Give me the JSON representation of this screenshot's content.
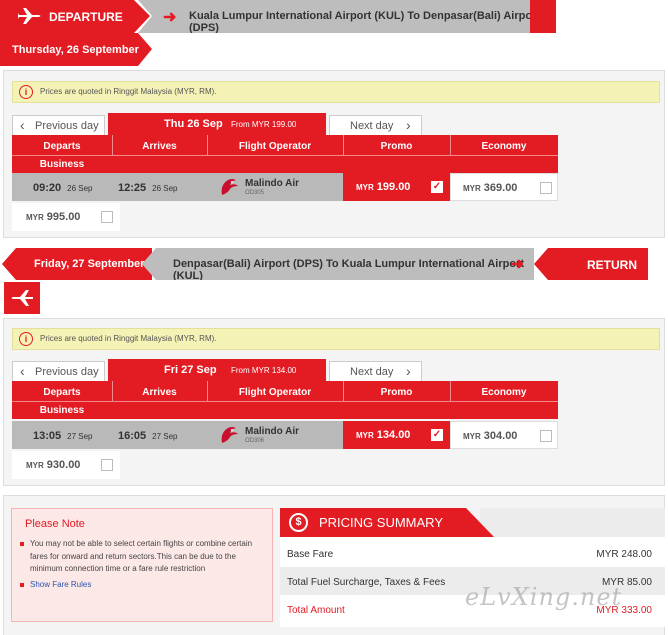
{
  "departure": {
    "label": "DEPARTURE",
    "route": "Kuala Lumpur International Airport (KUL) To Denpasar(Bali) Airport (DPS)",
    "date": "Thursday, 26 September",
    "notice": "Prices are quoted in Ringgit Malaysia (MYR, RM).",
    "prev_day": "Previous day",
    "selected_date": "Thu 26 Sep",
    "selected_from": "From MYR 199.00",
    "next_day": "Next day",
    "columns": {
      "departs": "Departs",
      "arrives": "Arrives",
      "operator": "Flight Operator",
      "promo": "Promo",
      "economy": "Economy",
      "business": "Business"
    },
    "flight": {
      "depart_time": "09:20",
      "depart_date": "26 Sep",
      "arrive_time": "12:25",
      "arrive_date": "26 Sep",
      "operator": "Malindo Air",
      "flight_no": "OD305",
      "promo_currency": "MYR",
      "promo_price": "199.00",
      "economy_currency": "MYR",
      "economy_price": "369.00",
      "business_currency": "MYR",
      "business_price": "995.00"
    }
  },
  "return": {
    "label": "RETURN",
    "route": "Denpasar(Bali) Airport (DPS) To Kuala Lumpur International Airport (KUL)",
    "date": "Friday, 27 September",
    "notice": "Prices are quoted in Ringgit Malaysia (MYR, RM).",
    "prev_day": "Previous day",
    "selected_date": "Fri 27 Sep",
    "selected_from": "From MYR 134.00",
    "next_day": "Next day",
    "columns": {
      "departs": "Departs",
      "arrives": "Arrives",
      "operator": "Flight Operator",
      "promo": "Promo",
      "economy": "Economy",
      "business": "Business"
    },
    "flight": {
      "depart_time": "13:05",
      "depart_date": "27 Sep",
      "arrive_time": "16:05",
      "arrive_date": "27 Sep",
      "operator": "Malindo Air",
      "flight_no": "OD306",
      "promo_currency": "MYR",
      "promo_price": "134.00",
      "economy_currency": "MYR",
      "economy_price": "304.00",
      "business_currency": "MYR",
      "business_price": "930.00"
    }
  },
  "note": {
    "title": "Please Note",
    "text": "You may not be able to select certain flights or combine certain fares for onward and return sectors.This can be due to the minimum connection time or a fare rule restriction",
    "link": "Show Fare Rules"
  },
  "summary": {
    "title": "PRICING SUMMARY",
    "base_fare_label": "Base Fare",
    "base_fare": "MYR 248.00",
    "fees_label": "Total Fuel Surcharge, Taxes & Fees",
    "fees": "MYR 85.00",
    "total_label": "Total Amount",
    "total": "MYR 333.00"
  },
  "watermark": "eLvXing.net",
  "icons": {
    "plane": "airplane-icon",
    "info": "info-icon",
    "dollar": "dollar-icon",
    "check": "checkmark-icon",
    "arrow": "arrow-icon",
    "chevron": "chevron-icon"
  },
  "colors": {
    "accent": "#e31b23",
    "route_bar": "#bdbdbd",
    "notice_bg": "#f5f2b6"
  }
}
